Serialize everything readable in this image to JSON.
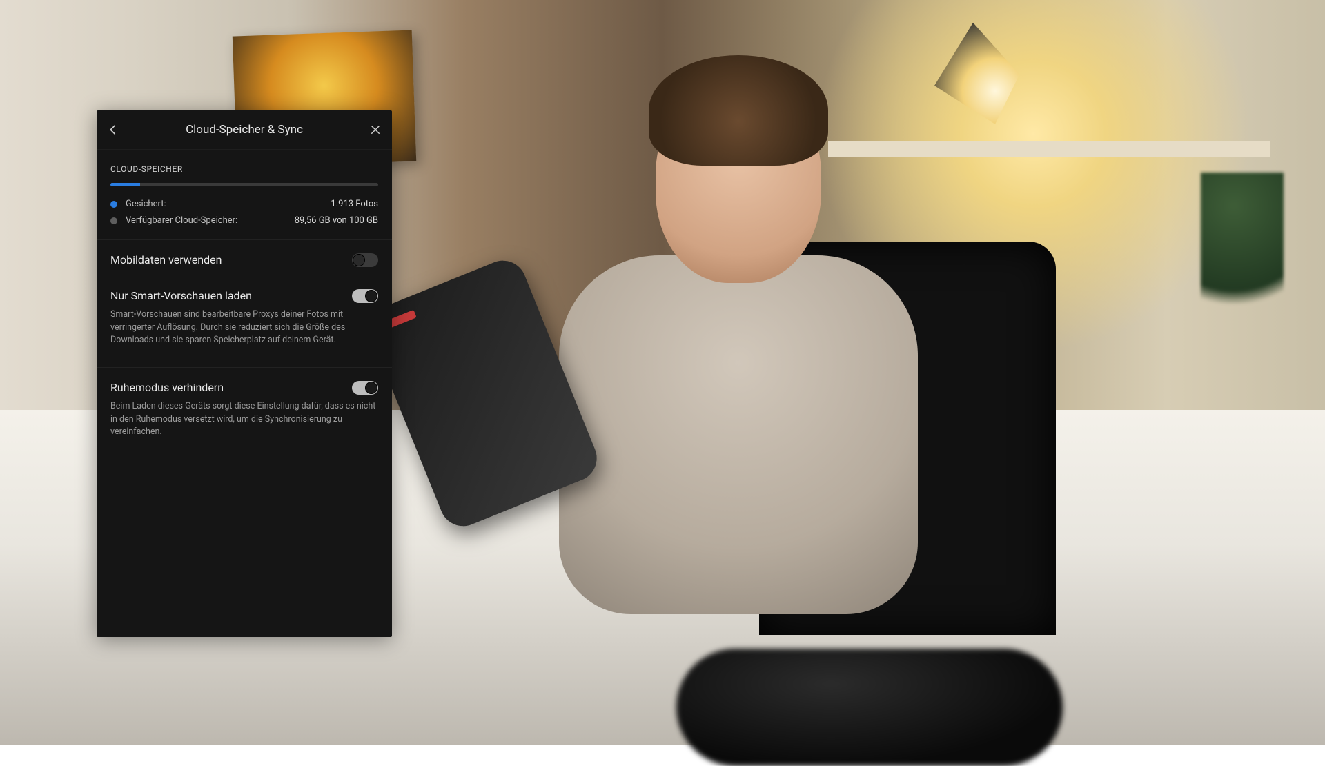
{
  "panel": {
    "title": "Cloud-Speicher & Sync",
    "section_label": "CLOUD-SPEICHER",
    "storage": {
      "used_percent": 11,
      "backed_up_label": "Gesichert:",
      "backed_up_value": "1.913 Fotos",
      "available_label": "Verfügbarer Cloud-Speicher:",
      "available_value": "89,56 GB von 100 GB"
    },
    "settings": {
      "mobile_data": {
        "label": "Mobildaten verwenden",
        "enabled": false
      },
      "smart_previews": {
        "label": "Nur Smart-Vorschauen laden",
        "enabled": true,
        "description": "Smart-Vorschauen sind bearbeitbare Proxys deiner Fotos mit verringerter Auflösung. Durch sie reduziert sich die Größe des Downloads und sie sparen Speicherplatz auf deinem Gerät."
      },
      "prevent_sleep": {
        "label": "Ruhemodus verhindern",
        "enabled": true,
        "description": "Beim Laden dieses Geräts sorgt diese Einstellung dafür, dass es nicht in den Ruhemodus versetzt wird, um die Synchronisierung zu vereinfachen."
      }
    }
  },
  "colors": {
    "accent": "#2a7de1",
    "panel_bg": "#151515"
  }
}
